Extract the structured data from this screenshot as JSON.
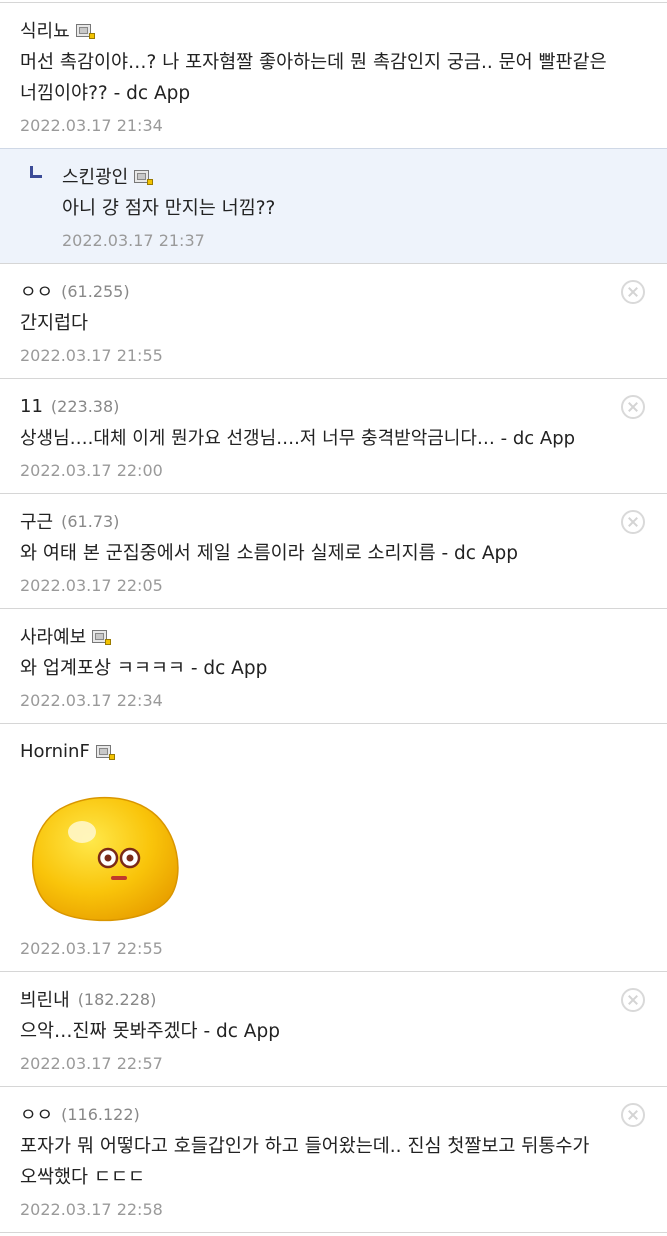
{
  "comments": [
    {
      "nick": "식리뇨",
      "ip": "",
      "text": "머선 촉감이야…? 나 포자혐짤 좋아하는데 뭔 촉감인지 궁금.. 문어 빨판같은 너낌이야?? - dc App",
      "date": "2022.03.17 21:34"
    },
    {
      "nick": "스킨광인",
      "ip": "",
      "text": "아니 걍 점자 만지는 너낌??",
      "date": "2022.03.17 21:37"
    },
    {
      "nick": "ㅇㅇ",
      "ip": "(61.255)",
      "text": "간지럽다",
      "date": "2022.03.17 21:55"
    },
    {
      "nick": "11",
      "ip": "(223.38)",
      "text": "상생님….대체 이게 뭔가요 선갱님….저 너무 충격받악금니다… - dc App",
      "date": "2022.03.17 22:00"
    },
    {
      "nick": "구근",
      "ip": "(61.73)",
      "text": "와 여태 본 군집중에서 제일 소름이라 실제로 소리지름 - dc App",
      "date": "2022.03.17 22:05"
    },
    {
      "nick": "사라예보",
      "ip": "",
      "text": "와 업계포상 ㅋㅋㅋㅋ - dc App",
      "date": "2022.03.17 22:34"
    },
    {
      "nick": "HorninF",
      "ip": "",
      "text": "",
      "date": "2022.03.17 22:55"
    },
    {
      "nick": "븨린내",
      "ip": "(182.228)",
      "text": "으악…진짜 못봐주겠다 - dc App",
      "date": "2022.03.17 22:57"
    },
    {
      "nick": "ㅇㅇ",
      "ip": "(116.122)",
      "text": "포자가 뭐 어떻다고 호들갑인가 하고 들어왔는데.. 진심 첫짤보고 뒤통수가 오싹했다 ㄷㄷㄷ",
      "date": "2022.03.17 22:58"
    }
  ],
  "colors": {
    "reply_bg": "#eef3fb",
    "reply_mark": "#3b4b97",
    "date": "#9a9a9a"
  },
  "icons": {
    "badge": "fixed-member-badge-icon",
    "delete": "delete-circle-x-icon",
    "reply": "reply-arrow-icon",
    "sticker": "yellow-blob-emoticon"
  }
}
